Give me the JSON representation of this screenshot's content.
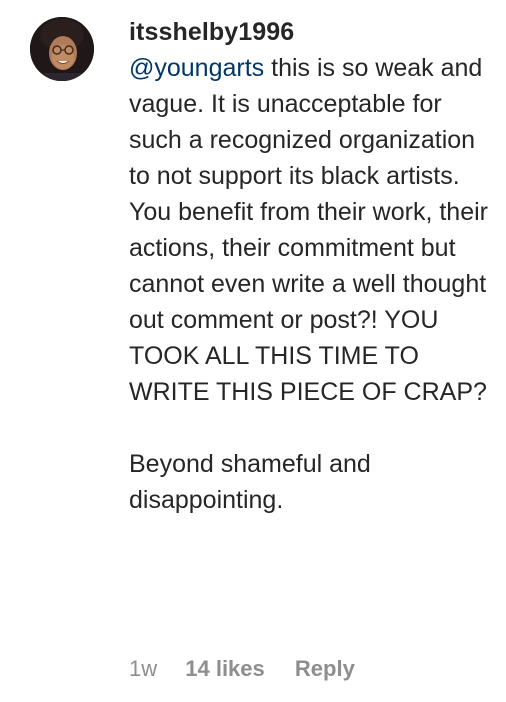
{
  "comment": {
    "username": "itsshelby1996",
    "mention": "@youngarts",
    "text_after_mention": " this is so weak and vague. It is unacceptable for such a recognized organization to not support its black artists. You benefit from their work, their actions, their commitment but cannot even write a well thought out comment or post?! YOU TOOK ALL THIS TIME TO WRITE THIS PIECE OF CRAP?",
    "second_paragraph": "Beyond shameful and disappointing.",
    "time_ago": "1w",
    "likes": "14 likes",
    "reply_label": "Reply"
  },
  "colors": {
    "text": "#262626",
    "mention": "#00376b",
    "meta": "#8e8e8e"
  }
}
